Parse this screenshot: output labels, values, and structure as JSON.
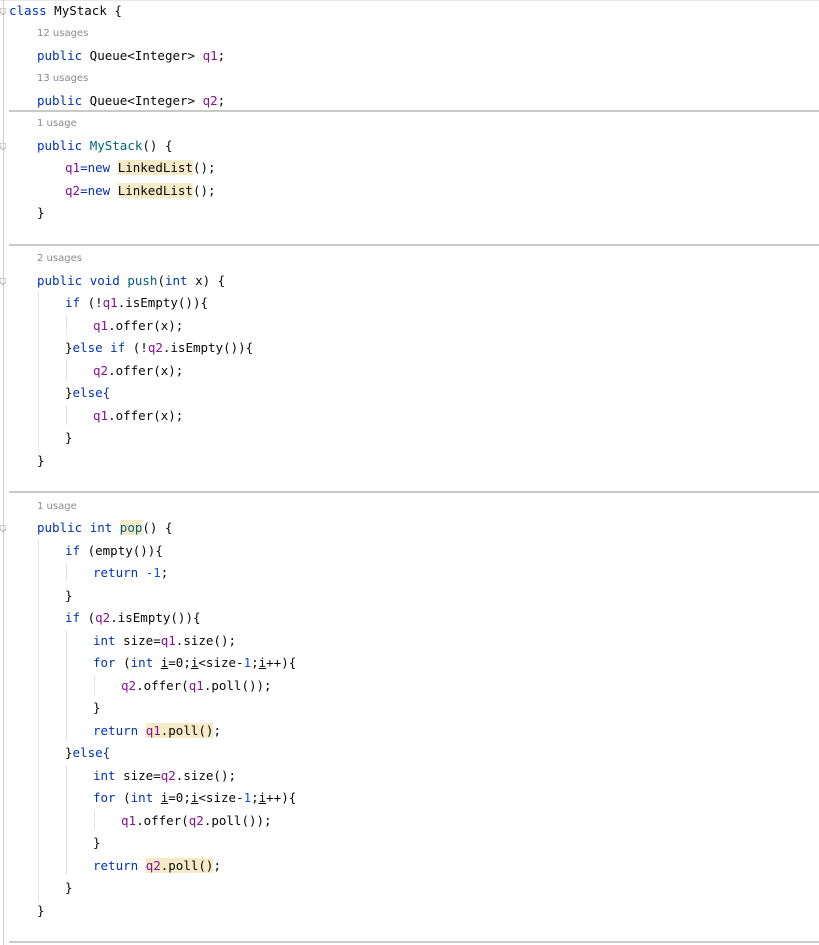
{
  "colors": {
    "keyword": "#0033b3",
    "field": "#871094",
    "method": "#00627a",
    "number": "#1750eb",
    "highlight": "#f6eac8",
    "hint": "#8a8a8a",
    "separator": "#c9c9c9"
  },
  "hints": {
    "h_q1": "12 usages",
    "h_q2": "13 usages",
    "h_ctor": "1 usage",
    "h_push": "2 usages",
    "h_pop": "1 usage"
  },
  "code": {
    "class_kw": "class",
    "class_name": " MyStack {",
    "public": "public",
    "queue_type": " Queue<Integer> ",
    "q1": "q1",
    "q2": "q2",
    "semi": ";",
    "ctor_name": "MyStack",
    "ctor_tail": "() {",
    "eq_new": "=new ",
    "linked_list": "LinkedList",
    "call_end": "();",
    "close_brace": "}",
    "void": "void",
    "push": "push",
    "int": "int",
    "push_params": "(",
    "push_x": " x) {",
    "if": "if",
    "not_open": " (!",
    "is_empty_brace": ".isEmpty()){",
    "offer_x": ".offer(x);",
    "else": "else",
    "else_brace": "else{",
    "pop": "pop",
    "pop_tail": "() {",
    "empty_cond": " (empty()){",
    "return": "return",
    "neg_one": "-1",
    "paren_open": " (",
    "size_eq": " size=",
    "size_call": ".size();",
    "for": "for",
    "i": "i",
    "eq_zero": "=0",
    "lt_size": "<size-",
    "one": "1",
    "inc": "++){",
    "offer_open": ".offer(",
    "poll_close": ".poll());",
    "poll_ret": ".poll()",
    "space": " "
  }
}
